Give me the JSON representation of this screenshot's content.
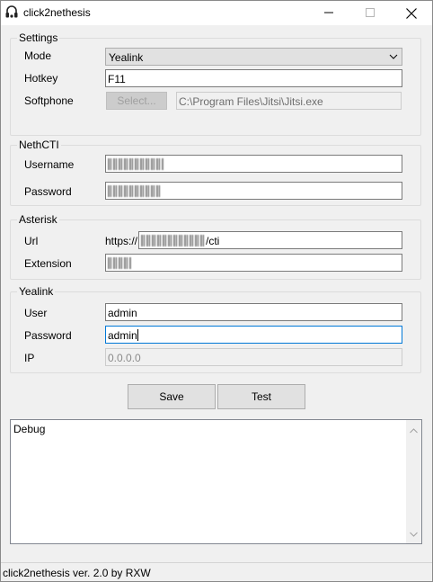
{
  "window": {
    "title": "click2nethesis",
    "app_icon": "headset-icon",
    "controls": [
      "minimize-icon",
      "maximize-icon",
      "close-icon"
    ]
  },
  "settings": {
    "group_title": "Settings",
    "mode_label": "Mode",
    "mode_value": "Yealink",
    "hotkey_label": "Hotkey",
    "hotkey_value": "F11",
    "softphone_label": "Softphone",
    "select_button": "Select...",
    "softphone_path": "C:\\Program Files\\Jitsi\\Jitsi.exe"
  },
  "nethcti": {
    "group_title": "NethCTI",
    "username_label": "Username",
    "password_label": "Password"
  },
  "asterisk": {
    "group_title": "Asterisk",
    "url_label": "Url",
    "url_prefix": "https://",
    "url_suffix": "/cti",
    "extension_label": "Extension"
  },
  "yealink": {
    "group_title": "Yealink",
    "user_label": "User",
    "user_value": "admin",
    "password_label": "Password",
    "password_value": "admin",
    "ip_label": "IP",
    "ip_placeholder": "0.0.0.0"
  },
  "actions": {
    "save_label": "Save",
    "test_label": "Test"
  },
  "debug": {
    "text": "Debug"
  },
  "status": {
    "text": "click2nethesis ver. 2.0 by RXW"
  },
  "colors": {
    "window_bg": "#f0f0f0",
    "focus_border": "#0078d7",
    "button_bg": "#e1e1e1"
  }
}
